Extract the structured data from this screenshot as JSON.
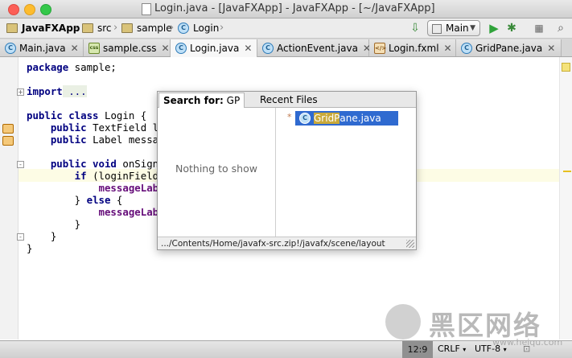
{
  "window": {
    "title": "Login.java - [JavaFXApp] - JavaFXApp - [~/JavaFXApp]",
    "traffic_lights": {
      "close": "#fc5f57",
      "minimize": "#fdbc2e",
      "zoom": "#34c84a"
    }
  },
  "navbar": {
    "breadcrumbs": [
      "JavaFXApp",
      "src",
      "sample",
      "Login"
    ],
    "run_config": "Main",
    "icons": [
      "build-icon",
      "run-icon",
      "debug-icon",
      "search-icon"
    ]
  },
  "tabs": [
    {
      "label": "Main.java",
      "type": "java",
      "active": false
    },
    {
      "label": "sample.css",
      "type": "css",
      "active": false
    },
    {
      "label": "Login.java",
      "type": "java",
      "active": true
    },
    {
      "label": "ActionEvent.java",
      "type": "java",
      "active": false
    },
    {
      "label": "Login.fxml",
      "type": "fxml",
      "active": false
    },
    {
      "label": "GridPane.java",
      "type": "java",
      "active": false
    }
  ],
  "editor": {
    "lines": {
      "l1a": "package",
      "l1b": " sample;",
      "l2a": "import",
      "l2b": " ...",
      "l3a": "public class",
      "l3b": " Login {",
      "l4a": "    public",
      "l4b": " TextField log",
      "l5a": "    public",
      "l5b": " Label message",
      "l6a": "    public void",
      "l6b": " onSignIn",
      "l7a": "        if",
      "l7b": " (loginField.g",
      "l8": "            messageLabel",
      "l9a": "        } ",
      "l9b": "else",
      "l9c": " {",
      "l10": "            messageLabel",
      "l11": "        }",
      "l12": "    }",
      "l13": "}"
    }
  },
  "popup": {
    "search_label": "Search for:",
    "search_query": "GP",
    "recent_tab": "Recent Files",
    "empty_text": "Nothing to show",
    "result": {
      "match": "GridP",
      "rest": "ane.java",
      "star": "*"
    },
    "status_path": ".../Contents/Home/javafx-src.zip!/javafx/scene/layout"
  },
  "statusbar": {
    "position": "12:9",
    "line_ending": "CRLF",
    "encoding": "UTF-8"
  },
  "watermark": {
    "title": "黑区网络",
    "url": "www.heiqu.com"
  }
}
